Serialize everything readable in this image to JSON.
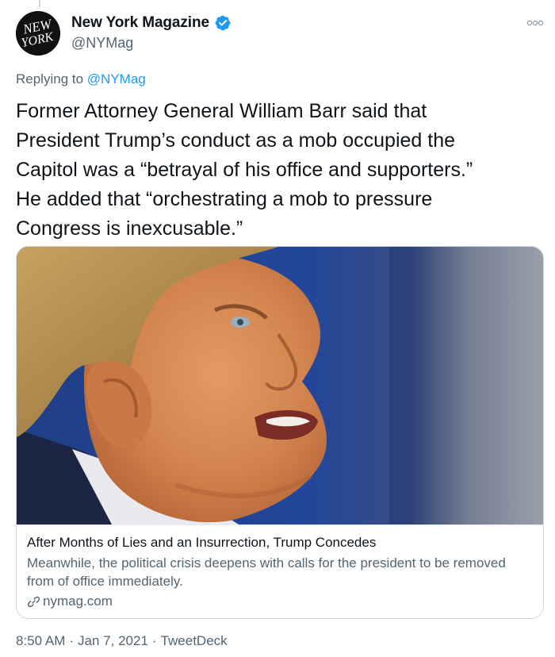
{
  "tweet": {
    "author": {
      "display_name": "New York Magazine",
      "handle": "@NYMag",
      "avatar_text": "NEW YORK",
      "verified": true
    },
    "replying_to_label": "Replying to ",
    "replying_to_handle": "@NYMag",
    "text": "Former Attorney General William Barr said that\nPresident Trump’s conduct as a mob occupied the\nCapitol was a “betrayal of his office and supporters.”\nHe added that “orchestrating a mob to pressure\nCongress is inexcusable.”",
    "card": {
      "title": "After Months of Lies and an Insurrection, Trump Concedes",
      "description": "Meanwhile, the political crisis deepens with calls for the president to be removed from of office immediately.",
      "domain": "nymag.com"
    },
    "time": "8:50 AM",
    "separator": "·",
    "date": "Jan 7, 2021",
    "source": "TweetDeck"
  },
  "icons": {
    "verified": "verified-badge-icon",
    "more": "more-options-icon",
    "link": "link-icon"
  },
  "colors": {
    "text": "#0f1419",
    "secondary": "#536471",
    "accent": "#1d9bf0",
    "border": "#cfd9de"
  }
}
